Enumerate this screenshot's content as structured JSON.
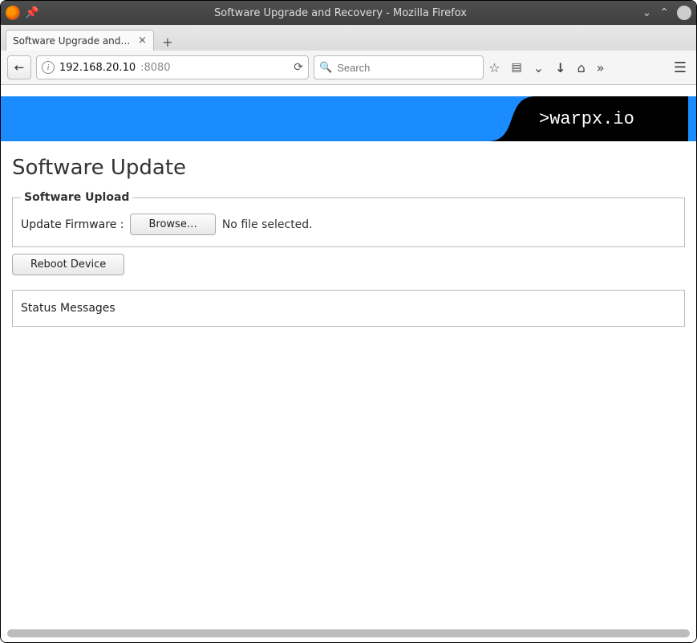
{
  "window": {
    "title": "Software Upgrade and Recovery - Mozilla Firefox"
  },
  "tab": {
    "title": "Software Upgrade and R…"
  },
  "url": {
    "host": "192.168.20.10",
    "port": ":8080"
  },
  "search": {
    "placeholder": "Search"
  },
  "banner": {
    "brand": ">warpx.io"
  },
  "page": {
    "title": "Software Update",
    "upload_legend": "Software Upload",
    "firmware_label": "Update Firmware :",
    "browse_label": "Browse…",
    "no_file": "No file selected.",
    "reboot_label": "Reboot Device",
    "status_heading": "Status Messages"
  }
}
